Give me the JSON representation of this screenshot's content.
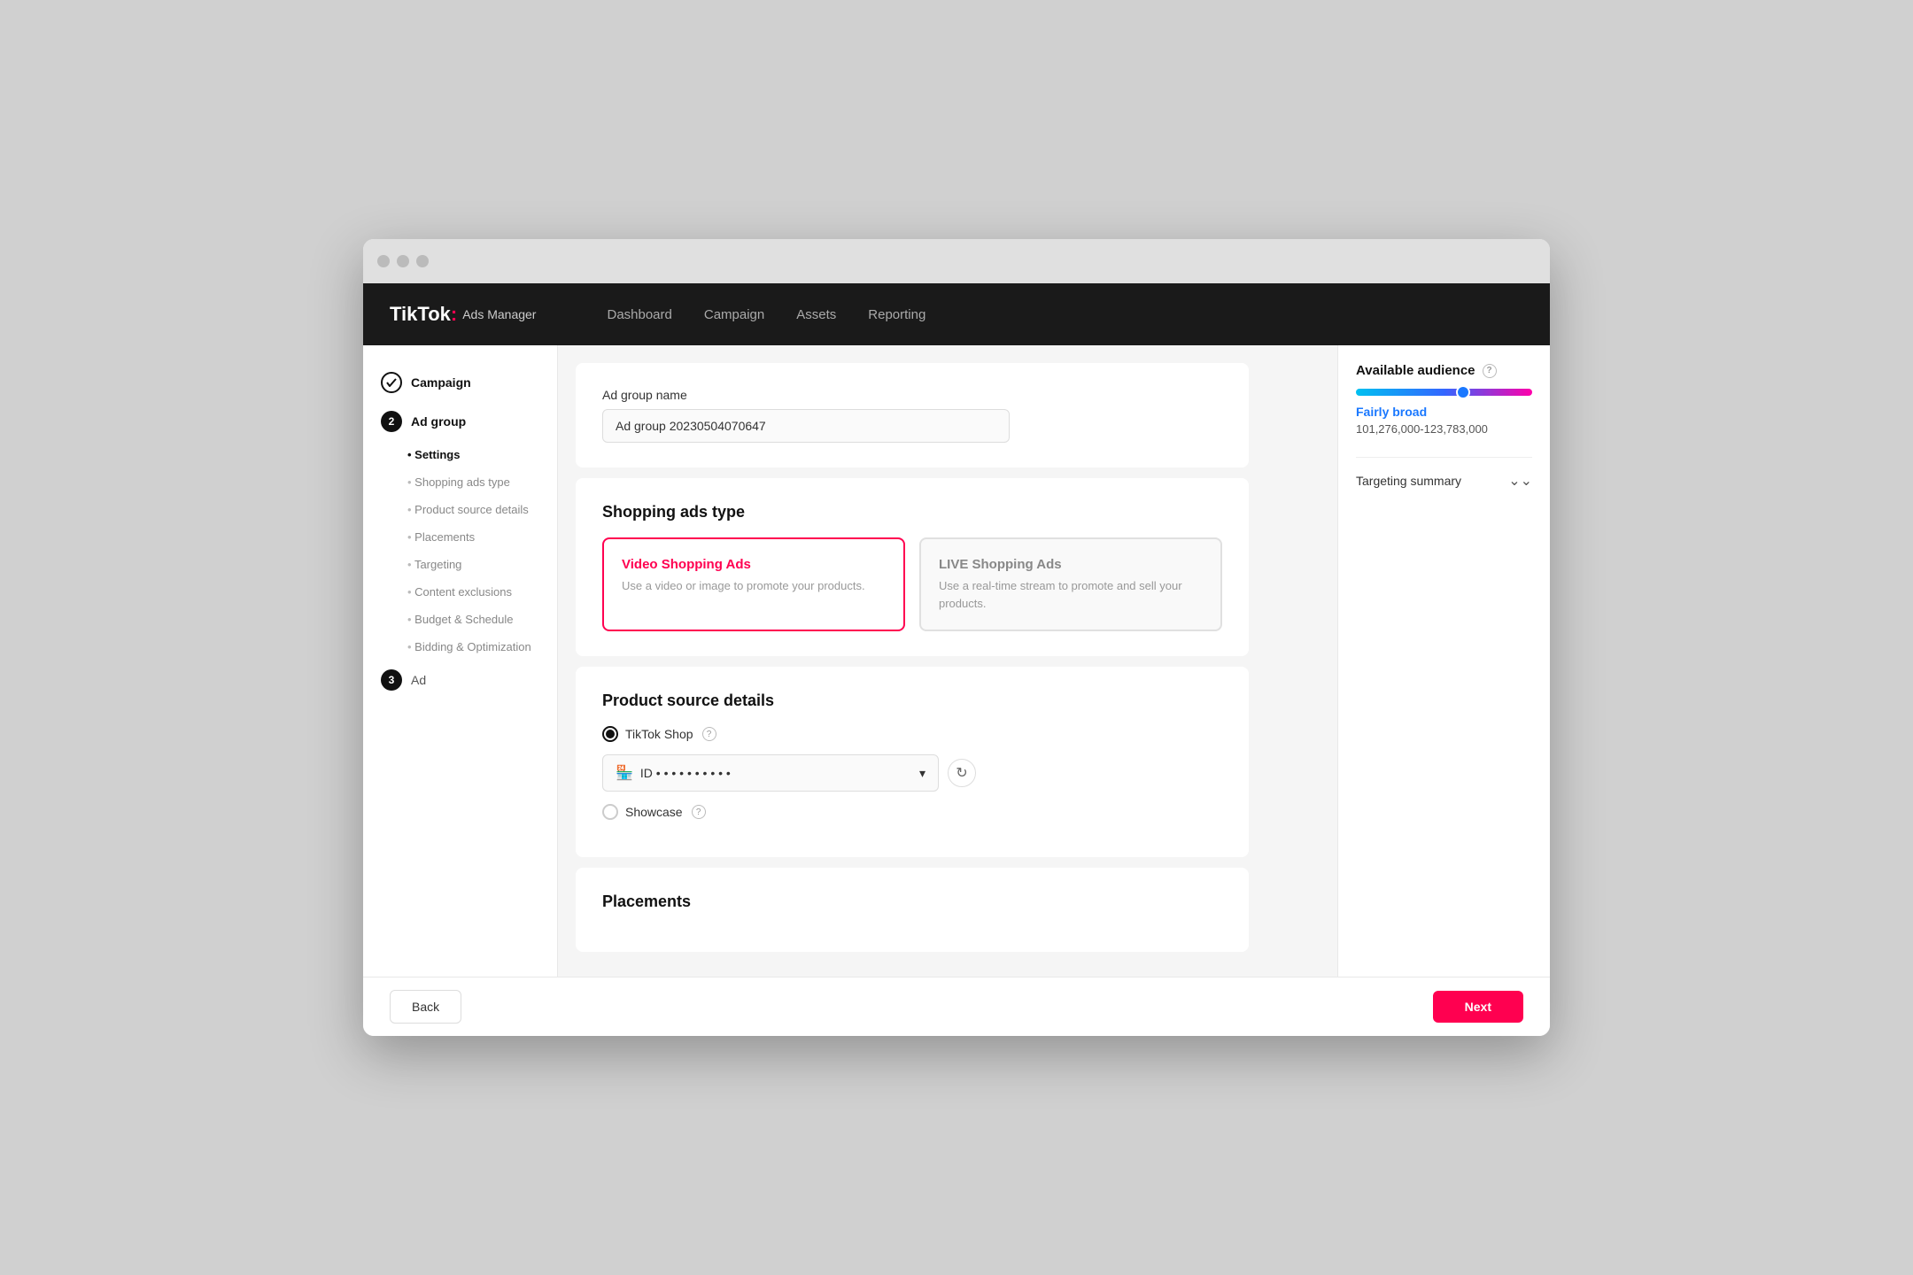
{
  "window": {
    "title": "TikTok Ads Manager"
  },
  "topnav": {
    "logo": "TikTok",
    "logo_dot": ":",
    "logo_sub": "Ads Manager",
    "links": [
      "Dashboard",
      "Campaign",
      "Assets",
      "Reporting"
    ]
  },
  "sidebar": {
    "step1_label": "Campaign",
    "step2_label": "Ad group",
    "step2_active_sub": "Settings",
    "sub_items": [
      "Shopping ads type",
      "Product source details",
      "Placements",
      "Targeting",
      "Content exclusions",
      "Budget & Schedule",
      "Bidding & Optimization"
    ],
    "step3_label": "Ad"
  },
  "ad_group_name": {
    "label": "Ad group name",
    "value": "Ad group 20230504070647"
  },
  "shopping_ads_type": {
    "title": "Shopping ads type",
    "cards": [
      {
        "title": "Video Shopping Ads",
        "desc": "Use a video or image to promote your products.",
        "selected": true
      },
      {
        "title": "LIVE Shopping Ads",
        "desc": "Use a real-time stream to promote and sell your products.",
        "selected": false
      }
    ]
  },
  "product_source": {
    "title": "Product source details",
    "tiktok_shop_label": "TikTok Shop",
    "tiktok_shop_selected": true,
    "dropdown_value": "ID • • • • • • • • • •",
    "showcase_label": "Showcase",
    "showcase_selected": false
  },
  "placements": {
    "title": "Placements"
  },
  "audience": {
    "title": "Available audience",
    "label": "Fairly broad",
    "range": "101,276,000-123,783,000"
  },
  "targeting_summary": {
    "label": "Targeting summary",
    "icon": "⌄⌄"
  },
  "footer": {
    "back_label": "Back",
    "next_label": "Next"
  }
}
